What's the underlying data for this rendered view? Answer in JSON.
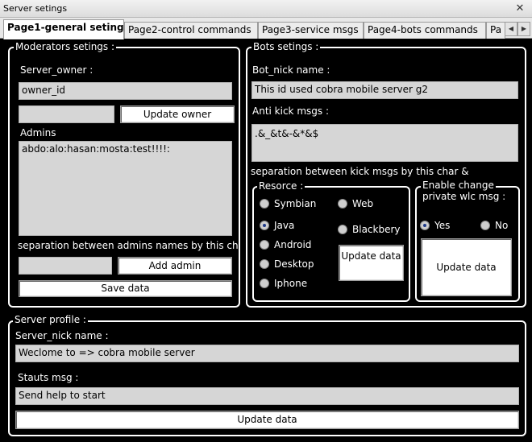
{
  "window": {
    "title": "Server setings"
  },
  "tabs": [
    {
      "label": "Page1-general setings"
    },
    {
      "label": "Page2-control commands"
    },
    {
      "label": "Page3-service msgs"
    },
    {
      "label": "Page4-bots commands"
    },
    {
      "label": "Pa"
    }
  ],
  "moderators": {
    "legend": "Moderators setings :",
    "server_owner_label": "Server_owner :",
    "owner_value": "owner_id",
    "owner_input_value": "",
    "update_owner_label": "Update owner",
    "admins_label": "Admins",
    "admins_value": "abdo:alo:hasan:mosta:test!!!!:",
    "separation_text": "separation between admins names by this ch",
    "add_admin_input_value": "",
    "add_admin_label": "Add admin",
    "save_label": "Save data"
  },
  "bots": {
    "legend": "Bots setings :",
    "nick_label": "Bot_nick name :",
    "nick_value": "This id used cobra mobile server g2",
    "anti_kick_label": "Anti kick msgs :",
    "anti_kick_value": ".&_&t&-&*&$",
    "separation_text": "separation between kick msgs by this char &",
    "resource": {
      "legend": "Resorce :",
      "options": [
        "Symbian",
        "Web",
        "Java",
        "Blackbery",
        "Android",
        "Desktop",
        "Iphone"
      ],
      "selected": "Java",
      "update_label": "Update data"
    },
    "welcome": {
      "legend_line1": "Enable change",
      "legend_line2": "private wlc msg :",
      "options": [
        "Yes",
        "No"
      ],
      "selected": "Yes",
      "update_label": "Update data"
    }
  },
  "profile": {
    "legend": "Server profile :",
    "nick_label": "Server_nick name :",
    "nick_value": "Weclome to => cobra mobile server",
    "status_label": "Stauts msg :",
    "status_value": "Send help to start",
    "update_label": "Update data"
  }
}
